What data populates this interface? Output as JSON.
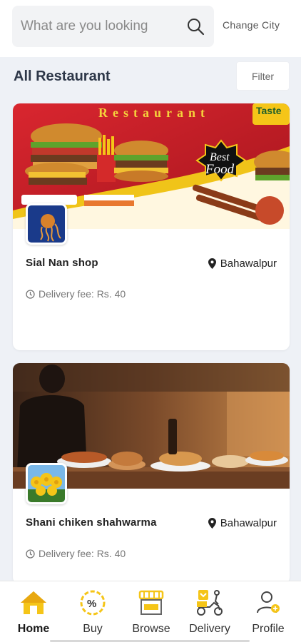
{
  "search": {
    "placeholder": "What are you looking"
  },
  "header": {
    "change_city": "Change City"
  },
  "section": {
    "title": "All Restaurant",
    "filter_label": "Filter"
  },
  "restaurants": [
    {
      "banner": {
        "title": "Restaurant",
        "badge": "Taste",
        "best": "Best",
        "food": "Food"
      },
      "name": "Sial Nan shop",
      "city": "Bahawalpur",
      "fee": "Delivery fee: Rs. 40"
    },
    {
      "name": "Shani chiken shahwarma",
      "city": "Bahawalpur",
      "fee": "Delivery fee: Rs. 40"
    }
  ],
  "nav": [
    {
      "label": "Home",
      "icon": "home-icon",
      "active": true
    },
    {
      "label": "Buy",
      "icon": "discount-icon"
    },
    {
      "label": "Browse",
      "icon": "shop-icon"
    },
    {
      "label": "Delivery",
      "icon": "scooter-icon"
    },
    {
      "label": "Profile",
      "icon": "profile-icon"
    }
  ],
  "colors": {
    "accent": "#f5c518",
    "banner_red": "#c8232c"
  }
}
